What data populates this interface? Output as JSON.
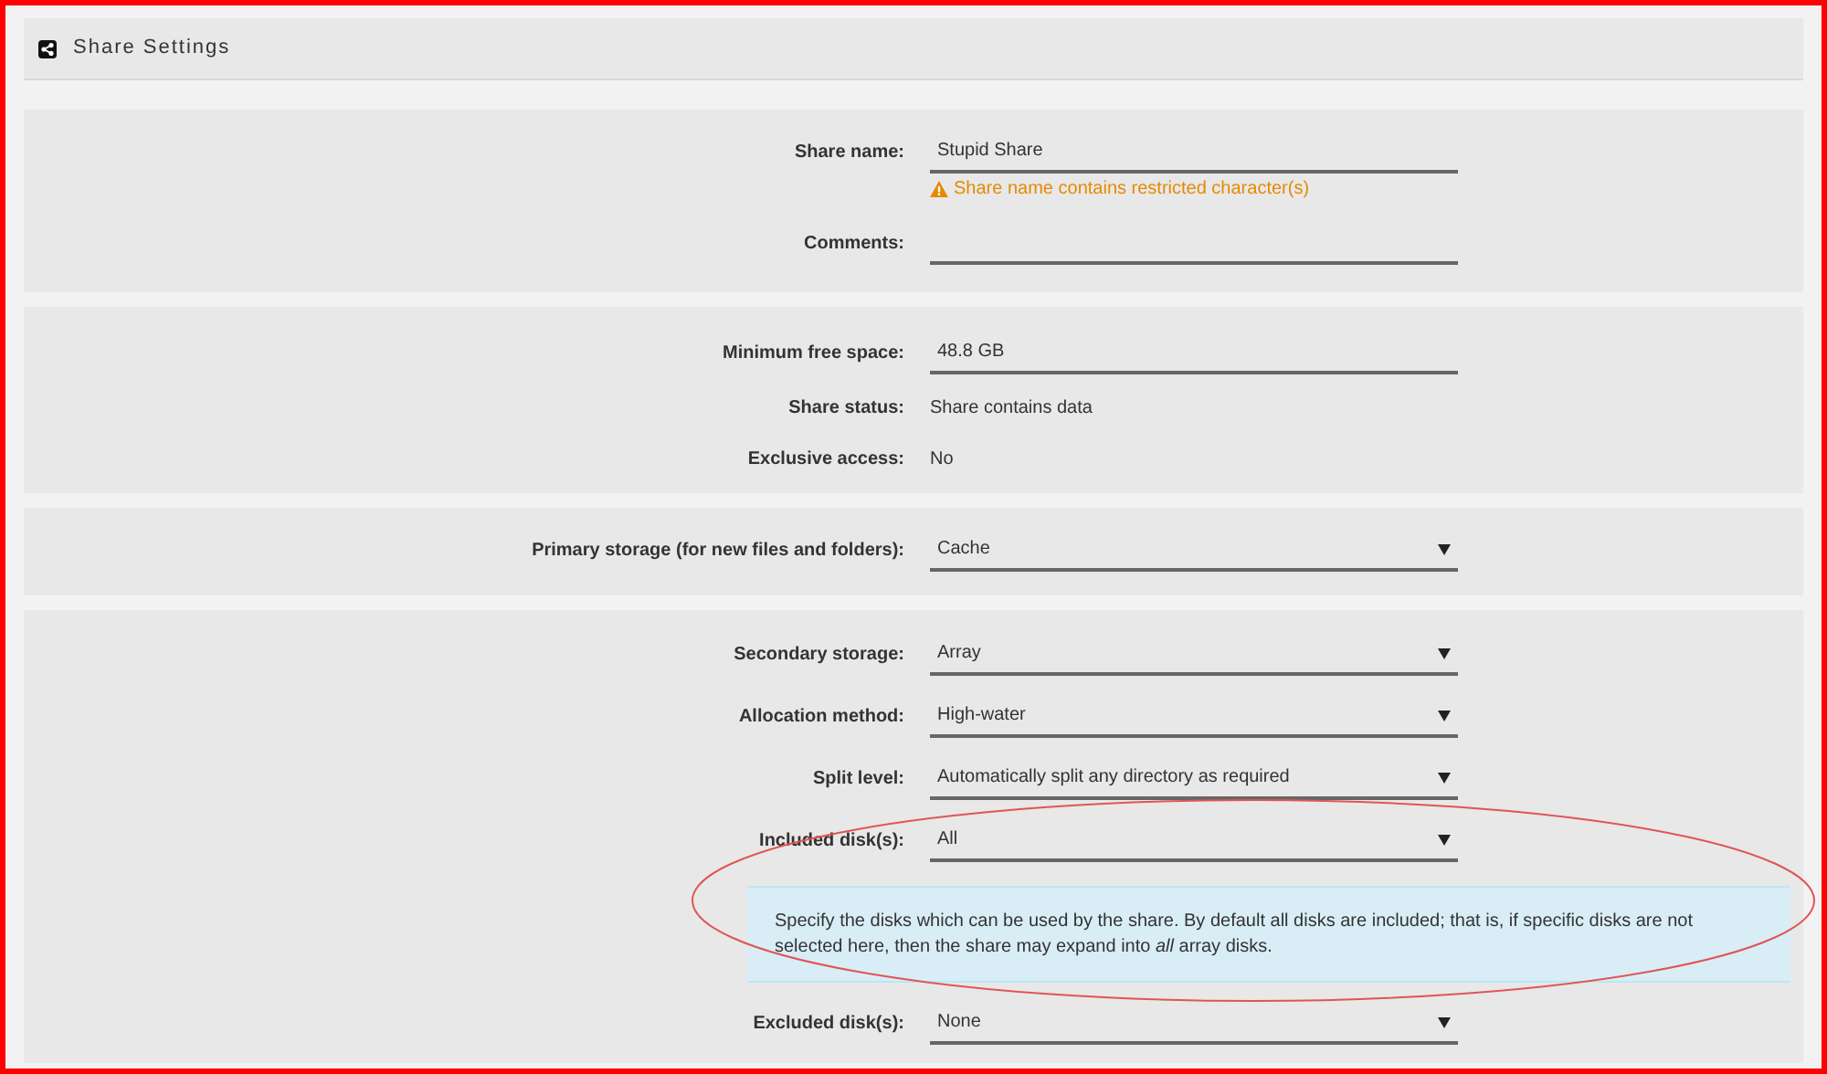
{
  "header": {
    "title": "Share Settings"
  },
  "sections": [
    {
      "rows": [
        {
          "kind": "input",
          "label": "Share name:",
          "value": "Stupid Share",
          "warning": "Share name contains restricted character(s)"
        },
        {
          "kind": "input",
          "label": "Comments:"
        }
      ]
    },
    {
      "rows": [
        {
          "kind": "input",
          "label": "Minimum free space:",
          "value": "48.8 GB"
        },
        {
          "kind": "text",
          "label": "Share status:",
          "value": "Share contains data"
        },
        {
          "kind": "text",
          "label": "Exclusive access:",
          "value": "No"
        }
      ]
    },
    {
      "rows": [
        {
          "kind": "select",
          "label": "Primary storage (for new files and folders):",
          "value": "Cache"
        }
      ]
    },
    {
      "rows": [
        {
          "kind": "select",
          "label": "Secondary storage:",
          "value": "Array"
        },
        {
          "kind": "select",
          "label": "Allocation method:",
          "value": "High-water"
        },
        {
          "kind": "select",
          "label": "Split level:",
          "value": "Automatically split any directory as required"
        },
        {
          "kind": "select",
          "label": "Included disk(s):",
          "value": "All"
        },
        {
          "kind": "help",
          "text": "Specify the disks which can be used by the share. By default all disks are included; that is, if specific disks are not selected here, then the share may expand into *all* array disks."
        },
        {
          "kind": "select",
          "label": "Excluded disk(s):",
          "value": "None"
        }
      ]
    }
  ],
  "annotations": [
    {
      "kind": "ellipse"
    }
  ]
}
